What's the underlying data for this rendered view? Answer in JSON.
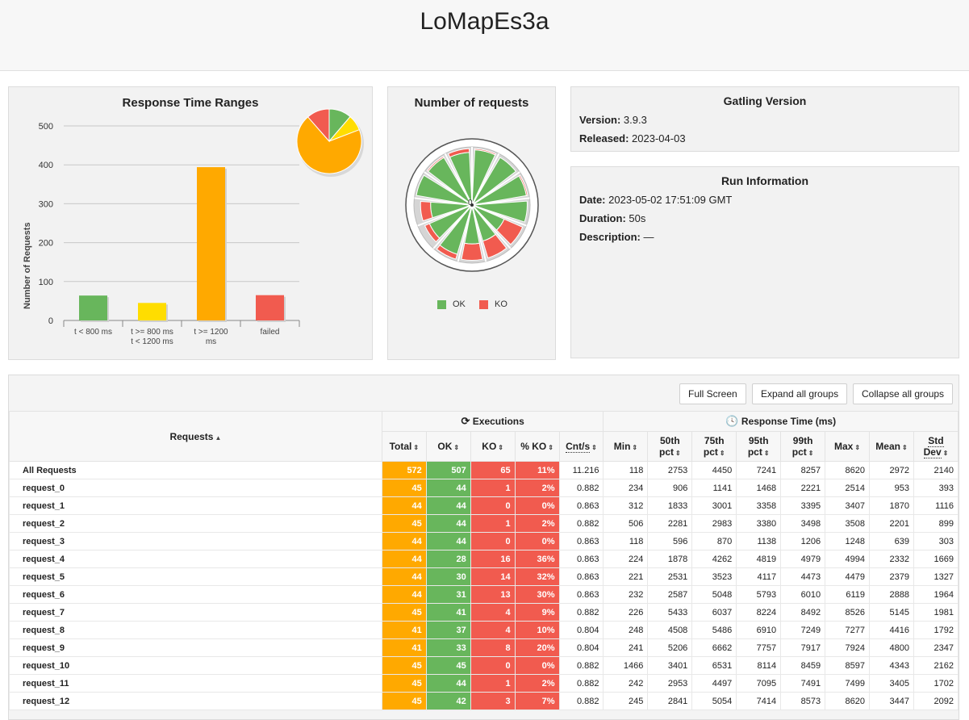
{
  "header": {
    "title": "LoMapEs3a"
  },
  "response_time_ranges": {
    "title": "Response Time Ranges",
    "ylabel": "Number of Requests",
    "yticks": [
      "500",
      "400",
      "300",
      "200",
      "100",
      "0"
    ],
    "categories": [
      {
        "line1": "t < 800 ms",
        "line2": ""
      },
      {
        "line1": "t >= 800 ms",
        "line2": "t < 1200 ms"
      },
      {
        "line1": "t >= 1200",
        "line2": "ms"
      },
      {
        "line1": "failed",
        "line2": ""
      }
    ]
  },
  "chart_data": [
    {
      "type": "bar",
      "title": "Response Time Ranges",
      "ylabel": "Number of Requests",
      "categories": [
        "t < 800 ms",
        "t >= 800 ms t < 1200 ms",
        "t >= 1200 ms",
        "failed"
      ],
      "values": [
        64,
        45,
        394,
        65
      ],
      "colors": [
        "#68b65c",
        "#ffdd00",
        "#ffa900",
        "#f15b4f"
      ],
      "ylim": [
        0,
        500
      ]
    },
    {
      "type": "pie",
      "categories": [
        "t < 800 ms",
        "t >= 800 ms t < 1200 ms",
        "t >= 1200 ms",
        "failed"
      ],
      "values": [
        64,
        45,
        394,
        65
      ],
      "colors": [
        "#68b65c",
        "#ffdd00",
        "#ffa900",
        "#f15b4f"
      ]
    },
    {
      "type": "pie",
      "title": "Number of requests",
      "categories": [
        "request_0",
        "request_1",
        "request_2",
        "request_3",
        "request_4",
        "request_5",
        "request_6",
        "request_7",
        "request_8",
        "request_9",
        "request_10",
        "request_11",
        "request_12"
      ],
      "series": [
        {
          "name": "OK",
          "values": [
            44,
            44,
            44,
            44,
            28,
            30,
            31,
            41,
            37,
            33,
            45,
            44,
            42
          ]
        },
        {
          "name": "KO",
          "values": [
            1,
            0,
            1,
            0,
            16,
            14,
            13,
            4,
            4,
            8,
            0,
            1,
            3
          ]
        }
      ],
      "colors": {
        "OK": "#68b65c",
        "KO": "#f15b4f"
      }
    }
  ],
  "number_of_requests": {
    "title": "Number of requests",
    "center_label": "0",
    "legend": [
      {
        "label": "OK",
        "color": "#68b65c"
      },
      {
        "label": "KO",
        "color": "#f15b4f"
      }
    ]
  },
  "gatling_version": {
    "title": "Gatling Version",
    "version_label": "Version:",
    "version": "3.9.3",
    "released_label": "Released:",
    "released": "2023-04-03"
  },
  "run_information": {
    "title": "Run Information",
    "date_label": "Date:",
    "date": "2023-05-02 17:51:09 GMT",
    "duration_label": "Duration:",
    "duration": "50s",
    "description_label": "Description:",
    "description": "—"
  },
  "buttons": {
    "full_screen": "Full Screen",
    "expand": "Expand all groups",
    "collapse": "Collapse all groups"
  },
  "table": {
    "requests_header": "Requests",
    "executions_header": "Executions",
    "response_time_header": "Response Time (ms)",
    "columns": {
      "total": "Total",
      "ok": "OK",
      "ko": "KO",
      "pct_ko": "% KO",
      "cnt": "Cnt/s",
      "min": "Min",
      "p50_a": "50th",
      "p50_b": "pct",
      "p75_a": "75th",
      "p75_b": "pct",
      "p95_a": "95th",
      "p95_b": "pct",
      "p99_a": "99th",
      "p99_b": "pct",
      "max": "Max",
      "mean": "Mean",
      "std_a": "Std",
      "std_b": "Dev"
    },
    "rows": [
      {
        "name": "All Requests",
        "total": "572",
        "ok": "507",
        "ko": "65",
        "pct": "11%",
        "cnt": "11.216",
        "min": "118",
        "p50": "2753",
        "p75": "4450",
        "p95": "7241",
        "p99": "8257",
        "max": "8620",
        "mean": "2972",
        "std": "2140"
      },
      {
        "name": "request_0",
        "total": "45",
        "ok": "44",
        "ko": "1",
        "pct": "2%",
        "cnt": "0.882",
        "min": "234",
        "p50": "906",
        "p75": "1141",
        "p95": "1468",
        "p99": "2221",
        "max": "2514",
        "mean": "953",
        "std": "393"
      },
      {
        "name": "request_1",
        "total": "44",
        "ok": "44",
        "ko": "0",
        "pct": "0%",
        "cnt": "0.863",
        "min": "312",
        "p50": "1833",
        "p75": "3001",
        "p95": "3358",
        "p99": "3395",
        "max": "3407",
        "mean": "1870",
        "std": "1116"
      },
      {
        "name": "request_2",
        "total": "45",
        "ok": "44",
        "ko": "1",
        "pct": "2%",
        "cnt": "0.882",
        "min": "506",
        "p50": "2281",
        "p75": "2983",
        "p95": "3380",
        "p99": "3498",
        "max": "3508",
        "mean": "2201",
        "std": "899"
      },
      {
        "name": "request_3",
        "total": "44",
        "ok": "44",
        "ko": "0",
        "pct": "0%",
        "cnt": "0.863",
        "min": "118",
        "p50": "596",
        "p75": "870",
        "p95": "1138",
        "p99": "1206",
        "max": "1248",
        "mean": "639",
        "std": "303"
      },
      {
        "name": "request_4",
        "total": "44",
        "ok": "28",
        "ko": "16",
        "pct": "36%",
        "cnt": "0.863",
        "min": "224",
        "p50": "1878",
        "p75": "4262",
        "p95": "4819",
        "p99": "4979",
        "max": "4994",
        "mean": "2332",
        "std": "1669"
      },
      {
        "name": "request_5",
        "total": "44",
        "ok": "30",
        "ko": "14",
        "pct": "32%",
        "cnt": "0.863",
        "min": "221",
        "p50": "2531",
        "p75": "3523",
        "p95": "4117",
        "p99": "4473",
        "max": "4479",
        "mean": "2379",
        "std": "1327"
      },
      {
        "name": "request_6",
        "total": "44",
        "ok": "31",
        "ko": "13",
        "pct": "30%",
        "cnt": "0.863",
        "min": "232",
        "p50": "2587",
        "p75": "5048",
        "p95": "5793",
        "p99": "6010",
        "max": "6119",
        "mean": "2888",
        "std": "1964"
      },
      {
        "name": "request_7",
        "total": "45",
        "ok": "41",
        "ko": "4",
        "pct": "9%",
        "cnt": "0.882",
        "min": "226",
        "p50": "5433",
        "p75": "6037",
        "p95": "8224",
        "p99": "8492",
        "max": "8526",
        "mean": "5145",
        "std": "1981"
      },
      {
        "name": "request_8",
        "total": "41",
        "ok": "37",
        "ko": "4",
        "pct": "10%",
        "cnt": "0.804",
        "min": "248",
        "p50": "4508",
        "p75": "5486",
        "p95": "6910",
        "p99": "7249",
        "max": "7277",
        "mean": "4416",
        "std": "1792"
      },
      {
        "name": "request_9",
        "total": "41",
        "ok": "33",
        "ko": "8",
        "pct": "20%",
        "cnt": "0.804",
        "min": "241",
        "p50": "5206",
        "p75": "6662",
        "p95": "7757",
        "p99": "7917",
        "max": "7924",
        "mean": "4800",
        "std": "2347"
      },
      {
        "name": "request_10",
        "total": "45",
        "ok": "45",
        "ko": "0",
        "pct": "0%",
        "cnt": "0.882",
        "min": "1466",
        "p50": "3401",
        "p75": "6531",
        "p95": "8114",
        "p99": "8459",
        "max": "8597",
        "mean": "4343",
        "std": "2162"
      },
      {
        "name": "request_11",
        "total": "45",
        "ok": "44",
        "ko": "1",
        "pct": "2%",
        "cnt": "0.882",
        "min": "242",
        "p50": "2953",
        "p75": "4497",
        "p95": "7095",
        "p99": "7491",
        "max": "7499",
        "mean": "3405",
        "std": "1702"
      },
      {
        "name": "request_12",
        "total": "45",
        "ok": "42",
        "ko": "3",
        "pct": "7%",
        "cnt": "0.882",
        "min": "245",
        "p50": "2841",
        "p75": "5054",
        "p95": "7414",
        "p99": "8573",
        "max": "8620",
        "mean": "3447",
        "std": "2092"
      }
    ]
  }
}
